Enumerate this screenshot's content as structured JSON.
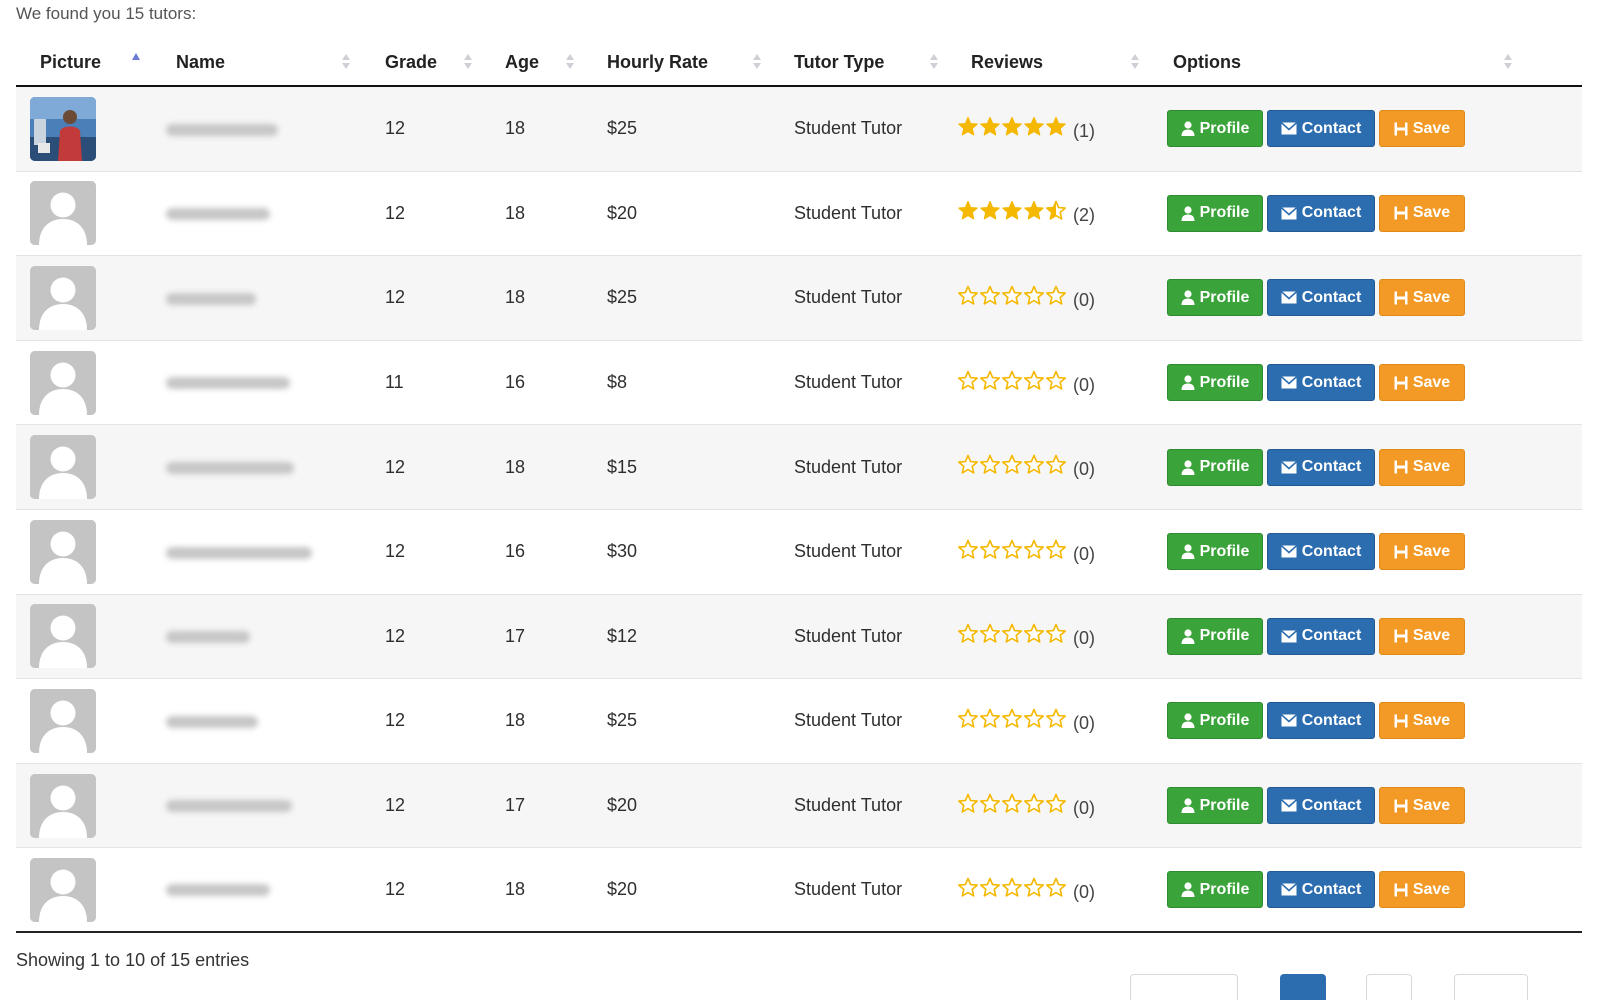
{
  "summary_text": "We found you 15 tutors:",
  "columns": {
    "picture": "Picture",
    "name": "Name",
    "grade": "Grade",
    "age": "Age",
    "hourly_rate": "Hourly Rate",
    "tutor_type": "Tutor Type",
    "reviews": "Reviews",
    "options": "Options"
  },
  "sort": {
    "column": "picture",
    "direction": "ascending"
  },
  "buttons": {
    "profile": "Profile",
    "contact": "Contact",
    "save": "Save"
  },
  "rows": [
    {
      "grade": "12",
      "age": "18",
      "rate": "$25",
      "type": "Student Tutor",
      "rating": 5,
      "reviews": "(1)",
      "photo": true
    },
    {
      "grade": "12",
      "age": "18",
      "rate": "$20",
      "type": "Student Tutor",
      "rating": 4.5,
      "reviews": "(2)",
      "photo": false
    },
    {
      "grade": "12",
      "age": "18",
      "rate": "$25",
      "type": "Student Tutor",
      "rating": 0,
      "reviews": "(0)",
      "photo": false
    },
    {
      "grade": "11",
      "age": "16",
      "rate": "$8",
      "type": "Student Tutor",
      "rating": 0,
      "reviews": "(0)",
      "photo": false
    },
    {
      "grade": "12",
      "age": "18",
      "rate": "$15",
      "type": "Student Tutor",
      "rating": 0,
      "reviews": "(0)",
      "photo": false
    },
    {
      "grade": "12",
      "age": "16",
      "rate": "$30",
      "type": "Student Tutor",
      "rating": 0,
      "reviews": "(0)",
      "photo": false
    },
    {
      "grade": "12",
      "age": "17",
      "rate": "$12",
      "type": "Student Tutor",
      "rating": 0,
      "reviews": "(0)",
      "photo": false
    },
    {
      "grade": "12",
      "age": "18",
      "rate": "$25",
      "type": "Student Tutor",
      "rating": 0,
      "reviews": "(0)",
      "photo": false
    },
    {
      "grade": "12",
      "age": "17",
      "rate": "$20",
      "type": "Student Tutor",
      "rating": 0,
      "reviews": "(0)",
      "photo": false
    },
    {
      "grade": "12",
      "age": "18",
      "rate": "$20",
      "type": "Student Tutor",
      "rating": 0,
      "reviews": "(0)",
      "photo": false
    }
  ],
  "footer": {
    "info": "Showing 1 to 10 of 15 entries"
  },
  "icons": {
    "sort_indicator": "sort-arrows-icon",
    "profile": "user-icon",
    "contact": "envelope-icon",
    "save": "floppy-disk-icon",
    "rating": "star-icon",
    "avatar_placeholder": "default-avatar-icon"
  },
  "colors": {
    "profile_button": "#3aa33a",
    "contact_button": "#2c6db0",
    "save_button": "#f29a25",
    "star": "#f5b800",
    "sort_active": "#6c7bd6",
    "avatar_placeholder": "#c4c4c4"
  }
}
